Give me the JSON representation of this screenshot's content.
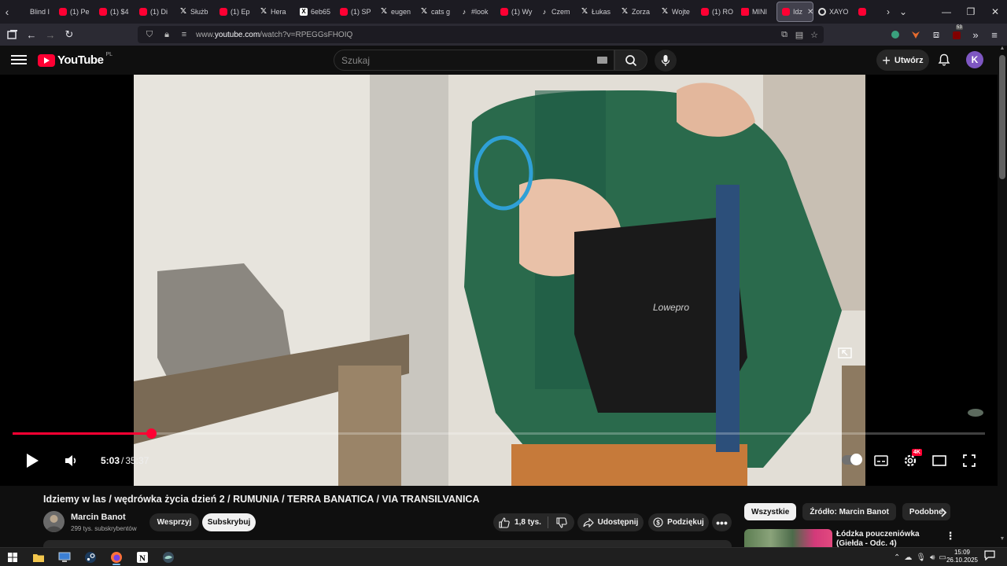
{
  "browser": {
    "tabs": [
      {
        "label": "Blind I",
        "icon": "blank"
      },
      {
        "label": "(1) Pe",
        "icon": "youtube"
      },
      {
        "label": "(1) $4",
        "icon": "youtube"
      },
      {
        "label": "(1) Di",
        "icon": "youtube"
      },
      {
        "label": "Służb",
        "icon": "x"
      },
      {
        "label": "(1) Ep",
        "icon": "youtube"
      },
      {
        "label": "Hera",
        "icon": "x"
      },
      {
        "label": "6eb65",
        "icon": "xbox"
      },
      {
        "label": "(1) SP",
        "icon": "youtube"
      },
      {
        "label": "eugen",
        "icon": "x"
      },
      {
        "label": "cats g",
        "icon": "x"
      },
      {
        "label": "#look",
        "icon": "tiktok"
      },
      {
        "label": "(1) Wy",
        "icon": "youtube"
      },
      {
        "label": "Czem",
        "icon": "tiktok"
      },
      {
        "label": "Łukas",
        "icon": "x"
      },
      {
        "label": "Zorza",
        "icon": "x"
      },
      {
        "label": "Wojte",
        "icon": "x"
      },
      {
        "label": "(1) RO",
        "icon": "youtube"
      },
      {
        "label": "MINI",
        "icon": "mini"
      },
      {
        "label": "Idz",
        "icon": "youtube",
        "active": true
      },
      {
        "label": "XAYO",
        "icon": "record"
      },
      {
        "label": "",
        "icon": "youtube"
      }
    ],
    "tab_close_glyph": "✕",
    "url_prefix": "www.",
    "url_host": "youtube.com",
    "url_path": "/watch?v=RPEGGsFHOIQ",
    "extension_badge": "53"
  },
  "youtube": {
    "logo_text": "YouTube",
    "region": "PL",
    "search_placeholder": "Szukaj",
    "create_label": "Utwórz",
    "avatar_letter": "K"
  },
  "player": {
    "current_time": "5:03",
    "separator": "/",
    "duration": "35:37",
    "progress_fraction": 0.142,
    "quality_badge": "4K"
  },
  "video": {
    "title": "Idziemy w las / wędrówka życia dzień 2 / RUMUNIA / TERRA BANATICA / VIA TRANSILVANICA",
    "channel_name": "Marcin Banot",
    "subscribers": "299 tys. subskrybentów",
    "support_label": "Wesprzyj",
    "subscribe_label": "Subskrybuj",
    "like_count": "1,8 tys.",
    "share_label": "Udostępnij",
    "thanks_label": "Podziękuj",
    "more_label": "•••"
  },
  "sidebar": {
    "chips": [
      "Wszystkie",
      "Źródło: Marcin Banot",
      "Podobne"
    ],
    "recommendation_title": "Łódzka pouczeniówka (Giełda - Odc. 4)"
  },
  "taskbar": {
    "time": "15:09",
    "date": "26.10.2025"
  },
  "colors": {
    "brand": "#ff0033",
    "background": "#0f0f0f",
    "browser_chrome": "#1c1b22"
  }
}
